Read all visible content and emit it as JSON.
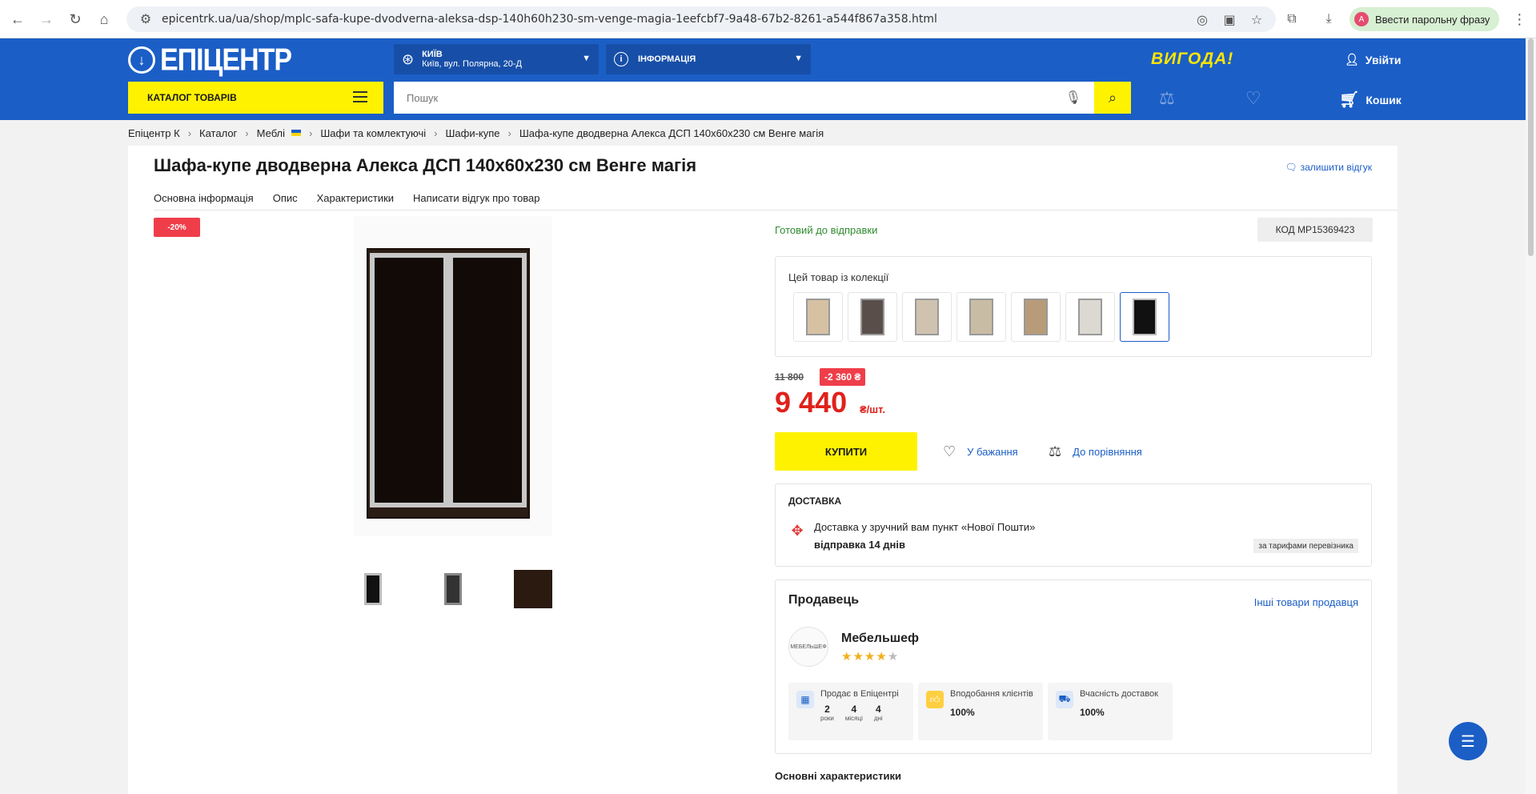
{
  "browser": {
    "url": "epicentrk.ua/ua/shop/mplc-safa-kupe-dvodverna-aleksa-dsp-140h60h230-sm-venge-magia-1eefcbf7-9a48-67b2-8261-a544f867a358.html",
    "passphrase_label": "Ввести парольну фразу",
    "profile_initial": "A"
  },
  "header": {
    "logo_text": "ЕПІЦЕНТР",
    "city_name": "КИЇВ",
    "city_address": "Київ, вул. Полярна, 20-Д",
    "info_label": "ІНФОРМАЦІЯ",
    "promo": "ВИГОДА!",
    "login": "Увійти",
    "catalog": "КАТАЛОГ ТОВАРІВ",
    "search_placeholder": "Пошук",
    "cart": "Кошик"
  },
  "breadcrumbs": [
    "Епіцентр К",
    "Каталог",
    "Меблі",
    "Шафи та комлектуючі",
    "Шафи-купе",
    "Шафа-купе дводверна Алекса ДСП 140х60х230 см Венге магія"
  ],
  "product": {
    "title": "Шафа-купе дводверна Алекса ДСП 140х60х230 см Венге магія",
    "leave_review": "залишити відгук",
    "tabs": [
      "Основна інформація",
      "Опис",
      "Характеристики",
      "Написати відгук про товар"
    ],
    "discount_badge": "-20%",
    "status": "Готовий до відправки",
    "code": "КОД MP15369423",
    "collection_title": "Цей товар із колекції",
    "old_price": "11 800",
    "save": "-2 360 ₴",
    "price": "9 440",
    "price_unit": "₴/шт.",
    "buy": "КУПИТИ",
    "wishlist": "У бажання",
    "compare": "До порівняння"
  },
  "delivery": {
    "title": "ДОСТАВКА",
    "text": "Доставка у зручний вам пункт «Нової Пошти»",
    "days": "відправка 14 днів",
    "tariff": "за тарифами перевізника"
  },
  "seller": {
    "title": "Продавець",
    "other_link": "Інші товари продавця",
    "name": "Мебельшеф",
    "logo_text": "МЕБЕЛЬШЕФ",
    "rating": 4,
    "stats": [
      {
        "label": "Продає в Епіцентрі",
        "years": "2",
        "years_u": "роки",
        "months": "4",
        "months_u": "місяці",
        "days": "4",
        "days_u": "дні"
      },
      {
        "label": "Вподобання клієнтів",
        "value": "100%"
      },
      {
        "label": "Вчасність доставок",
        "value": "100%"
      }
    ]
  },
  "main_chars": "Основні характеристики",
  "colors": {
    "brand_blue": "#1b5ec6",
    "accent_yellow": "#fff200",
    "price_red": "#e0211b",
    "ready_green": "#2e8b2e"
  }
}
